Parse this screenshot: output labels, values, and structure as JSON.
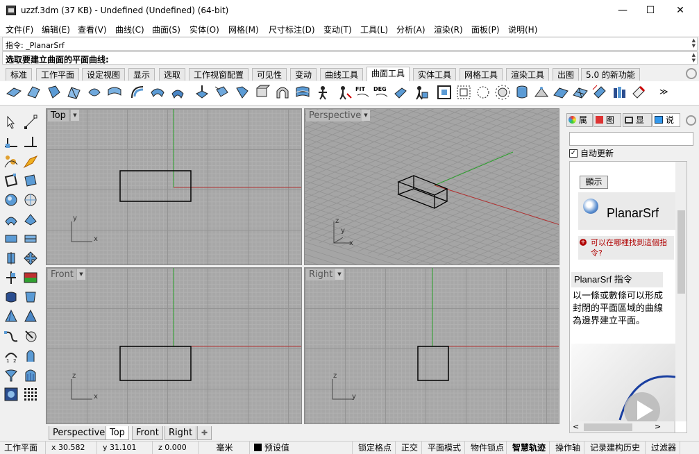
{
  "window": {
    "title": "uzzf.3dm (37 KB) - Undefined (Undefined) (64-bit)",
    "minimize": "—",
    "maximize": "☐",
    "close": "✕"
  },
  "menu": [
    "文件(F)",
    "编辑(E)",
    "查看(V)",
    "曲线(C)",
    "曲面(S)",
    "实体(O)",
    "网格(M)",
    "尺寸标注(D)",
    "变动(T)",
    "工具(L)",
    "分析(A)",
    "渲染(R)",
    "面板(P)",
    "说明(H)"
  ],
  "command": {
    "history": "指令: _PlanarSrf",
    "prompt": "选取要建立曲面的平面曲线:"
  },
  "tabs": [
    "标准",
    "工作平面",
    "设定视图",
    "显示",
    "选取",
    "工作视窗配置",
    "可见性",
    "变动",
    "曲线工具",
    "曲面工具",
    "实体工具",
    "网格工具",
    "渲染工具",
    "出图",
    "5.0 的新功能"
  ],
  "active_tab": "曲面工具",
  "toolbar_text_icons": {
    "fit": "FIT",
    "deg": "DEG",
    "more": "≫"
  },
  "viewports": {
    "top": {
      "title": "Top",
      "x": "x",
      "y": "y"
    },
    "perspective": {
      "title": "Perspective",
      "x": "x",
      "y": "y",
      "z": "z"
    },
    "front": {
      "title": "Front",
      "x": "x",
      "z": "z"
    },
    "right": {
      "title": "Right",
      "y": "y",
      "z": "z"
    }
  },
  "viewport_tabs": [
    "Perspective",
    "Top",
    "Front",
    "Right"
  ],
  "viewport_tab_add": "✚",
  "active_viewport_tab": "Top",
  "status": {
    "cplane": "工作平面",
    "x": "x 30.582",
    "y": "y 31.101",
    "z": "z 0.000",
    "units": "毫米",
    "layer": "预设值",
    "grid_snap": "锁定格点",
    "ortho": "正交",
    "planar": "平面模式",
    "osnap": "物件锁点",
    "smarttrack": "智慧轨迹",
    "gumball": "操作轴",
    "history": "记录建构历史",
    "filter": "过滤器"
  },
  "panel": {
    "tabs": [
      "属",
      "图",
      "显",
      "说"
    ],
    "active_tab": "说",
    "search_value": "",
    "auto_update": "自动更新",
    "auto_update_checked": true,
    "show_button": "顯示",
    "command_name": "PlanarSrf",
    "where_link": "可以在哪裡找到這個指令?",
    "section_title": "PlanarSrf 指令",
    "description": "以一條或數條可以形成封閉的平面區域的曲線為邊界建立平面。"
  },
  "colors": {
    "viewport_bg": "#a7a7a7",
    "x_axis": "#b03030",
    "y_axis": "#2aa02a",
    "link_red": "#b00000",
    "smarttrack_bold": true
  }
}
